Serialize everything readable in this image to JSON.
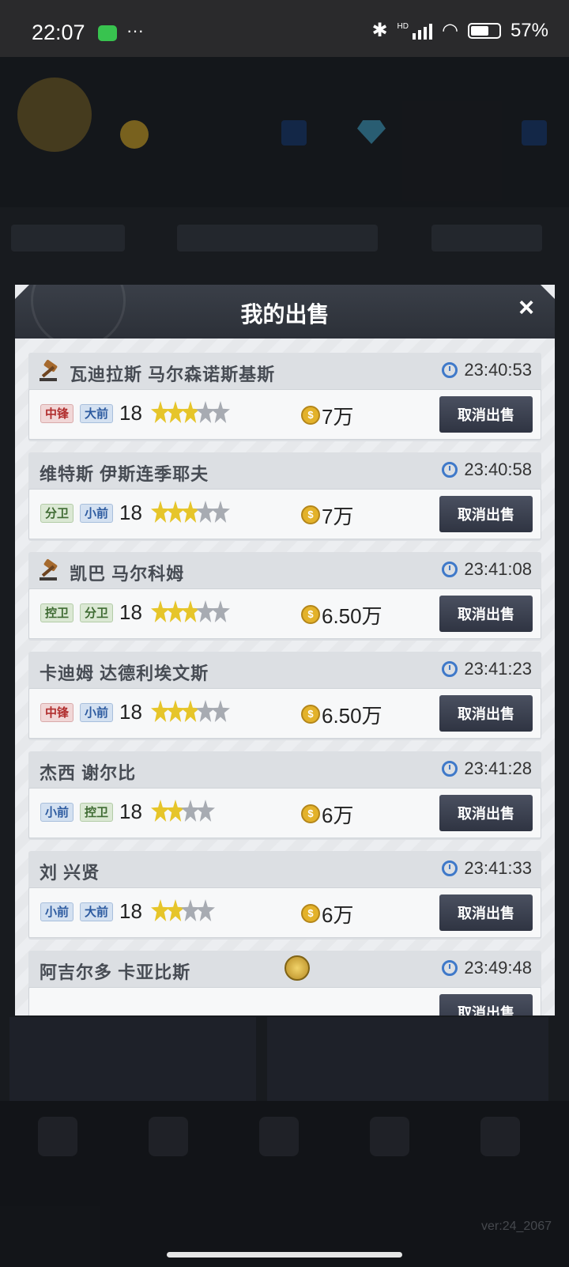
{
  "status_bar": {
    "time": "22:07",
    "dots": "···",
    "network": "HD",
    "battery_text": "57%"
  },
  "background_app": {
    "version": "ver:24_2067"
  },
  "modal": {
    "title": "我的出售",
    "close_icon": "×",
    "cancel_label": "取消出售",
    "items": [
      {
        "name": "瓦迪拉斯 马尔森诺斯基斯",
        "time": "23:40:53",
        "auction_icon": true,
        "positions": [
          {
            "label": "中锋",
            "color": "red"
          },
          {
            "label": "大前",
            "color": "blue"
          }
        ],
        "level": "18",
        "stars_gold": 3,
        "stars_total": 5,
        "price": "7万"
      },
      {
        "name": "维特斯 伊斯连季耶夫",
        "time": "23:40:58",
        "auction_icon": false,
        "positions": [
          {
            "label": "分卫",
            "color": "green"
          },
          {
            "label": "小前",
            "color": "blue"
          }
        ],
        "level": "18",
        "stars_gold": 3,
        "stars_total": 5,
        "price": "7万"
      },
      {
        "name": "凯巴 马尔科姆",
        "time": "23:41:08",
        "auction_icon": true,
        "positions": [
          {
            "label": "控卫",
            "color": "green"
          },
          {
            "label": "分卫",
            "color": "green"
          }
        ],
        "level": "18",
        "stars_gold": 3,
        "stars_total": 5,
        "price": "6.50万"
      },
      {
        "name": "卡迪姆 达德利埃文斯",
        "time": "23:41:23",
        "auction_icon": false,
        "positions": [
          {
            "label": "中锋",
            "color": "red"
          },
          {
            "label": "小前",
            "color": "blue"
          }
        ],
        "level": "18",
        "stars_gold": 3,
        "stars_total": 5,
        "price": "6.50万"
      },
      {
        "name": "杰西 谢尔比",
        "time": "23:41:28",
        "auction_icon": false,
        "positions": [
          {
            "label": "小前",
            "color": "blue"
          },
          {
            "label": "控卫",
            "color": "green"
          }
        ],
        "level": "18",
        "stars_gold": 2,
        "stars_total": 4,
        "price": "6万"
      },
      {
        "name": "刘 兴贤",
        "time": "23:41:33",
        "auction_icon": false,
        "positions": [
          {
            "label": "小前",
            "color": "blue"
          },
          {
            "label": "大前",
            "color": "blue"
          }
        ],
        "level": "18",
        "stars_gold": 2,
        "stars_total": 4,
        "price": "6万"
      },
      {
        "name": "阿吉尔多 卡亚比斯",
        "time": "23:49:48",
        "auction_icon": false,
        "gold_badge": true,
        "positions": [],
        "level": "",
        "stars_gold": 0,
        "stars_total": 0,
        "price": ""
      }
    ]
  }
}
